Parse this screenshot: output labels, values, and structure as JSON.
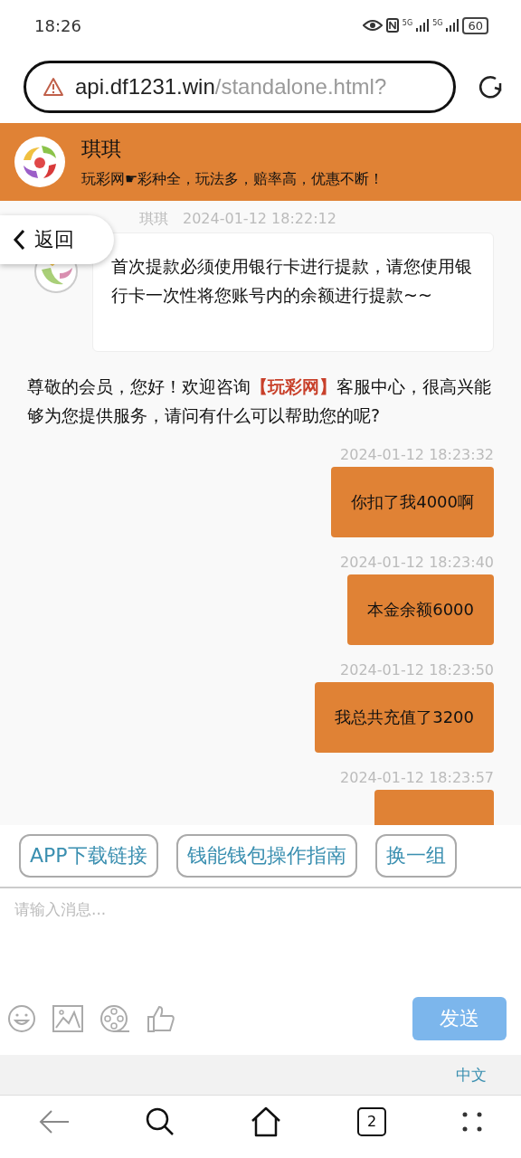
{
  "status_bar": {
    "time": "18:26",
    "network_1": "5G",
    "network_2": "5G",
    "battery": "60"
  },
  "address_bar": {
    "host": "api.df1231.win",
    "path": "/standalone.html?"
  },
  "header": {
    "name": "琪琪",
    "slogan": "玩彩网☛彩种全，玩法多，赔率高，优惠不断！"
  },
  "back_button": {
    "label": "返回"
  },
  "messages": [
    {
      "kind": "agent",
      "sender": "琪琪",
      "time": "2024-01-12 18:22:12",
      "text": "首次提款必须使用银行卡进行提款，请您使用银行卡一次性将您账号内的余额进行提款~~"
    },
    {
      "kind": "notice",
      "before": "尊敬的会员，您好！欢迎咨询",
      "highlight": "【玩彩网】",
      "after": "客服中心，很高兴能够为您提供服务，请问有什么可以帮助您的呢?"
    },
    {
      "kind": "user",
      "time": "2024-01-12 18:23:32",
      "text": "你扣了我4000啊"
    },
    {
      "kind": "user",
      "time": "2024-01-12 18:23:40",
      "text": "本金余额6000"
    },
    {
      "kind": "user",
      "time": "2024-01-12 18:23:50",
      "text": "我总共充值了3200"
    },
    {
      "kind": "user",
      "time": "2024-01-12 18:23:57"
    }
  ],
  "quick_replies": [
    "APP下载链接",
    "钱能钱包操作指南",
    "换一组"
  ],
  "input": {
    "placeholder": "请输入消息..."
  },
  "send_button": "发送",
  "language": "中文",
  "tab_count": "2"
}
